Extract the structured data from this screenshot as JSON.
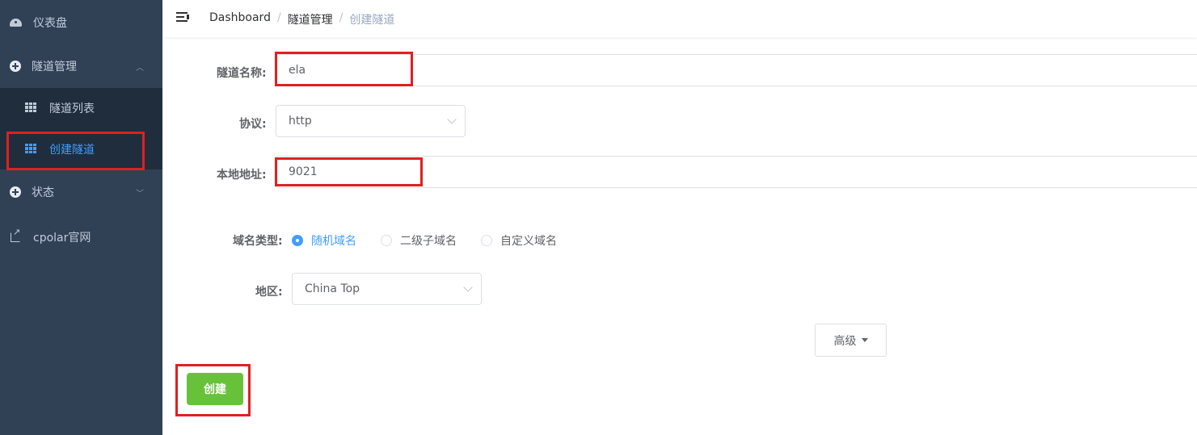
{
  "sidebar": {
    "dashboard_label": "仪表盘",
    "tunnel_mgmt_label": "隧道管理",
    "tunnel_list_label": "隧道列表",
    "create_tunnel_label": "创建隧道",
    "status_label": "状态",
    "cpolar_label": "cpolar官网",
    "active_color": "#409eff"
  },
  "header": {
    "breadcrumb": [
      "Dashboard",
      "隧道管理",
      "创建隧道"
    ],
    "separator": "/"
  },
  "form": {
    "name_label": "隧道名称:",
    "name_value": "ela",
    "protocol_label": "协议:",
    "protocol_value": "http",
    "address_label": "本地地址:",
    "address_value": "9021",
    "domain_type_label": "域名类型:",
    "domain_types": [
      "随机域名",
      "二级子域名",
      "自定义域名"
    ],
    "domain_type_selected": "随机域名",
    "region_label": "地区:",
    "region_value": "China Top",
    "advanced_label": "高级",
    "create_label": "创建",
    "create_color": "#67c23a"
  }
}
